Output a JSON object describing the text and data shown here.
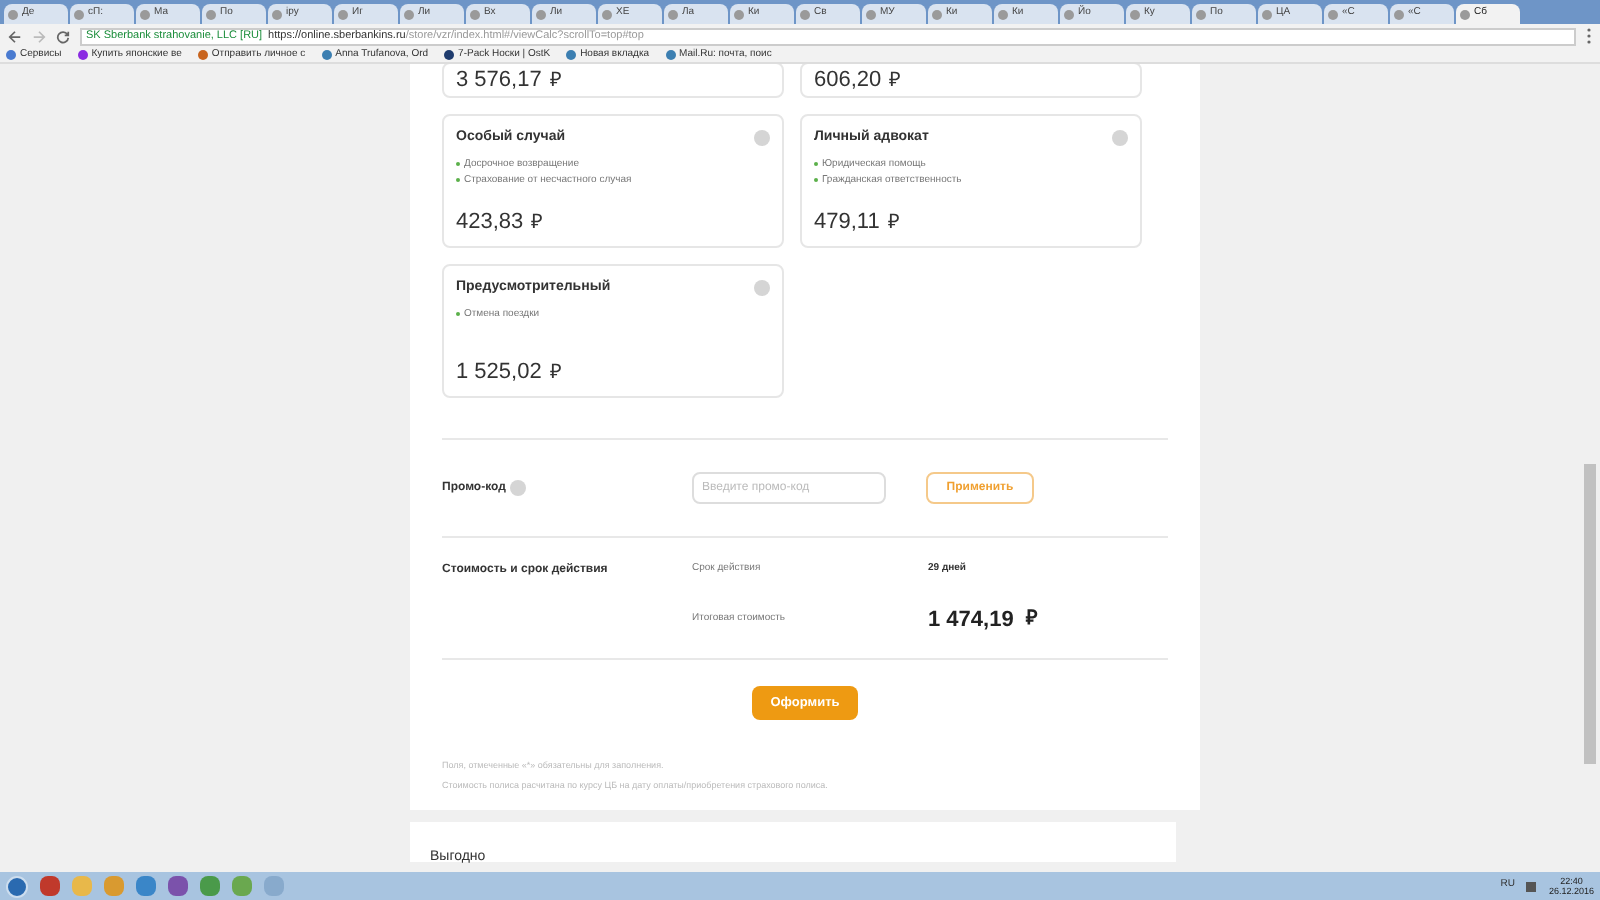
{
  "browser": {
    "tabs": [
      {
        "label": "Де",
        "selected": false
      },
      {
        "label": "сП:",
        "selected": false
      },
      {
        "label": "Ма",
        "selected": false
      },
      {
        "label": "По",
        "selected": false
      },
      {
        "label": "ipy",
        "selected": false
      },
      {
        "label": "Иг",
        "selected": false
      },
      {
        "label": "Ли",
        "selected": false
      },
      {
        "label": "Вх",
        "selected": false
      },
      {
        "label": "Ли",
        "selected": false
      },
      {
        "label": "XE",
        "selected": false
      },
      {
        "label": "Ла",
        "selected": false
      },
      {
        "label": "Ки",
        "selected": false
      },
      {
        "label": "Св",
        "selected": false
      },
      {
        "label": "МУ",
        "selected": false
      },
      {
        "label": "Ки",
        "selected": false
      },
      {
        "label": "Ки",
        "selected": false
      },
      {
        "label": "Йо",
        "selected": false
      },
      {
        "label": "Ку",
        "selected": false
      },
      {
        "label": "По",
        "selected": false
      },
      {
        "label": "ЦА",
        "selected": false
      },
      {
        "label": "«С",
        "selected": false
      },
      {
        "label": "«С",
        "selected": false
      },
      {
        "label": "Сб",
        "selected": true
      }
    ],
    "site_label": "SK Sberbank strahovanie, LLC [RU]",
    "url_host": "https://online.sberbankins.ru",
    "url_path": "/store/vzr/index.html#/viewCalc?scrollTo=top#top",
    "bookmarks": [
      {
        "label": "Сервисы",
        "color": "#4a7bd0"
      },
      {
        "label": "Купить японские ве",
        "color": "#8a2be2"
      },
      {
        "label": "Отправить личное с",
        "color": "#c8641e"
      },
      {
        "label": "Anna Trufanova, Ord",
        "color": "#3c7fb1"
      },
      {
        "label": "7-Pack Носки | OstK",
        "color": "#1f3c6e"
      },
      {
        "label": "Новая вкладка",
        "color": "#3c7fb1"
      },
      {
        "label": "Mail.Ru: почта, поис",
        "color": "#3c7fb1"
      }
    ]
  },
  "cards": [
    {
      "price": "3 576,17",
      "currency": "₽"
    },
    {
      "price": "606,20",
      "currency": "₽"
    },
    {
      "title": "Особый случай",
      "features": [
        "Досрочное возвращение",
        "Страхование от несчастного случая"
      ],
      "price": "423,83",
      "currency": "₽"
    },
    {
      "title": "Личный адвокат",
      "features": [
        "Юридическая помощь",
        "Гражданская ответственность"
      ],
      "price": "479,11",
      "currency": "₽"
    },
    {
      "title": "Предусмотрительный",
      "features": [
        "Отмена поездки"
      ],
      "price": "1 525,02",
      "currency": "₽"
    }
  ],
  "promo": {
    "label": "Промо-код",
    "placeholder": "Введите промо-код",
    "button": "Применить"
  },
  "cost": {
    "label": "Стоимость и срок действия",
    "period_label": "Срок действия",
    "period_value": "29 дней",
    "total_label": "Итоговая стоимость",
    "total_value": "1 474,19",
    "currency": "₽"
  },
  "submit": "Оформить",
  "notes": [
    "Поля, отмеченные «*» обязательны для заполнения.",
    "Стоимость полиса расчитана по курсу ЦБ на дату оплаты/приобретения страхового полиса."
  ],
  "next_section": "Выгодно",
  "taskbar": {
    "language": "RU",
    "time": "22:40",
    "date": "26.12.2016"
  }
}
